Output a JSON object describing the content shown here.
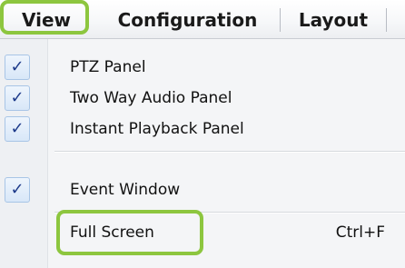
{
  "menubar": {
    "items": [
      {
        "label": "View"
      },
      {
        "label": "Configuration"
      },
      {
        "label": "Layout"
      }
    ]
  },
  "view_menu": {
    "items": [
      {
        "label": "PTZ Panel",
        "checked": true,
        "shortcut": ""
      },
      {
        "label": "Two Way Audio Panel",
        "checked": true,
        "shortcut": ""
      },
      {
        "label": "Instant Playback Panel",
        "checked": true,
        "shortcut": ""
      },
      {
        "label": "Event Window",
        "checked": true,
        "shortcut": ""
      },
      {
        "label": "Full Screen",
        "checked": false,
        "shortcut": "Ctrl+F"
      }
    ],
    "check_glyph": "✓"
  },
  "colors": {
    "highlight": "#8dc63f",
    "check": "#1d3a8a",
    "menu_background": "#f4f5f7"
  },
  "icons": {
    "check": "checkmark-icon"
  }
}
